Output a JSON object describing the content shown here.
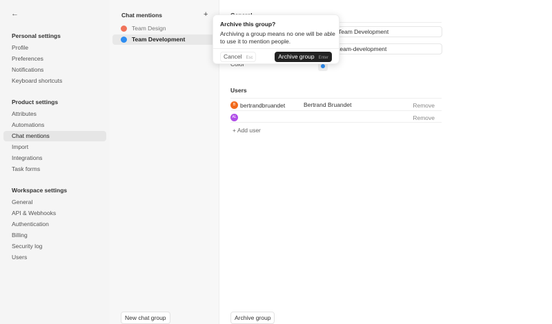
{
  "sidebar": {
    "back": "←",
    "personal": {
      "title": "Personal settings",
      "items": [
        "Profile",
        "Preferences",
        "Notifications",
        "Keyboard shortcuts"
      ]
    },
    "product": {
      "title": "Product settings",
      "items": [
        "Attributes",
        "Automations",
        "Chat mentions",
        "Import",
        "Integrations",
        "Task forms"
      ]
    },
    "workspace": {
      "title": "Workspace settings",
      "items": [
        "General",
        "API & Webhooks",
        "Authentication",
        "Billing",
        "Security log",
        "Users"
      ]
    }
  },
  "groups": {
    "title": "Chat mentions",
    "add": "+",
    "items": [
      {
        "label": "Team Design",
        "color": "#f0735a"
      },
      {
        "label": "Team Development",
        "color": "#2d8cf0"
      }
    ],
    "new_button": "New chat group"
  },
  "main": {
    "general": "General",
    "name_value": "Team Development",
    "handle_value": "team-development",
    "color_label": "Color",
    "users_title": "Users",
    "users": [
      {
        "username": "bertrandbruandet",
        "full": "Bertrand Bruandet",
        "avatar": "B",
        "remove": "Remove",
        "color": "#f26b1d"
      },
      {
        "username": "",
        "full": "",
        "avatar": "AL",
        "remove": "Remove",
        "color": "#b04ee8"
      }
    ],
    "add_user": "+ Add user",
    "archive_button": "Archive group"
  },
  "popover": {
    "title": "Archive this group?",
    "desc": "Archiving a group means no one will be able to use it to mention people.",
    "cancel": "Cancel",
    "cancel_key": "Esc",
    "confirm": "Archive group",
    "confirm_key": "Enter"
  }
}
